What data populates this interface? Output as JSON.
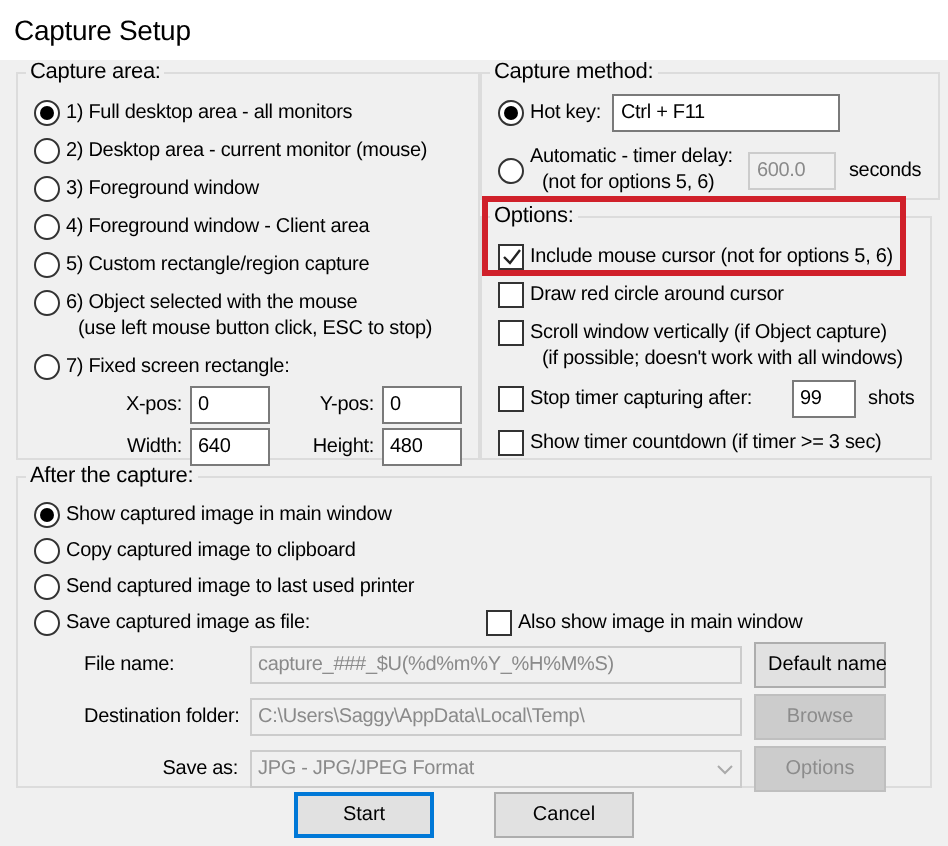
{
  "window": {
    "title": "Capture Setup"
  },
  "capture_area": {
    "label": "Capture area:",
    "options": [
      {
        "label": "1) Full desktop area - all monitors",
        "selected": true
      },
      {
        "label": "2) Desktop area - current monitor (mouse)",
        "selected": false
      },
      {
        "label": "3) Foreground window",
        "selected": false
      },
      {
        "label": "4) Foreground window - Client area",
        "selected": false
      },
      {
        "label": "5) Custom rectangle/region capture",
        "selected": false
      },
      {
        "label": "6) Object selected with the mouse",
        "note": "(use left mouse button click, ESC to stop)",
        "selected": false
      },
      {
        "label": "7) Fixed screen rectangle:",
        "selected": false
      }
    ],
    "rect_fields": [
      {
        "label": "X-pos:",
        "value": "0"
      },
      {
        "label": "Y-pos:",
        "value": "0"
      },
      {
        "label": "Width:",
        "value": "640"
      },
      {
        "label": "Height:",
        "value": "480"
      }
    ]
  },
  "capture_method": {
    "label": "Capture method:",
    "options": [
      {
        "label": "Hot key:",
        "selected": true,
        "field": {
          "value": "Ctrl + F11",
          "disabled": false
        }
      },
      {
        "label": "Automatic - timer delay:",
        "note": "(not for options 5, 6)",
        "selected": false,
        "field": {
          "value": "600.0",
          "disabled": true
        },
        "unit": "seconds"
      }
    ]
  },
  "options": {
    "label": "Options:",
    "highlighted": true,
    "items": [
      {
        "label": "Include mouse cursor (not for options 5, 6)",
        "checked": true
      },
      {
        "label": "Draw red circle around cursor",
        "checked": false
      },
      {
        "label": "Scroll window vertically (if Object capture)",
        "note": "(if possible; doesn't work with all windows)",
        "checked": false
      },
      {
        "label": "Stop timer capturing after:",
        "checked": false,
        "field": {
          "value": "99"
        },
        "unit": "shots"
      },
      {
        "label": "Show timer countdown (if timer >= 3 sec)",
        "checked": false
      }
    ]
  },
  "after_capture": {
    "label": "After the capture:",
    "options": [
      {
        "label": "Show captured image in main window",
        "selected": true
      },
      {
        "label": "Copy captured image to clipboard",
        "selected": false
      },
      {
        "label": "Send captured image to last used printer",
        "selected": false
      },
      {
        "label": "Save captured image as file:",
        "selected": false
      }
    ],
    "also_show": {
      "label": "Also show image in main window",
      "checked": false
    },
    "rows": [
      {
        "kind": "text",
        "label": "File name:",
        "value": "capture_###_$U(%d%m%Y_%H%M%S)",
        "disabled": true,
        "button": {
          "label": "Default name",
          "disabled": false
        }
      },
      {
        "kind": "text",
        "label": "Destination folder:",
        "value": "C:\\Users\\Saggy\\AppData\\Local\\Temp\\",
        "disabled": true,
        "button": {
          "label": "Browse",
          "disabled": true
        }
      },
      {
        "kind": "dropdown",
        "label": "Save as:",
        "value": "JPG - JPG/JPEG Format",
        "disabled": true,
        "button": {
          "label": "Options",
          "disabled": true
        }
      }
    ]
  },
  "buttons": [
    {
      "label": "Start",
      "default": true
    },
    {
      "label": "Cancel",
      "default": false
    }
  ]
}
